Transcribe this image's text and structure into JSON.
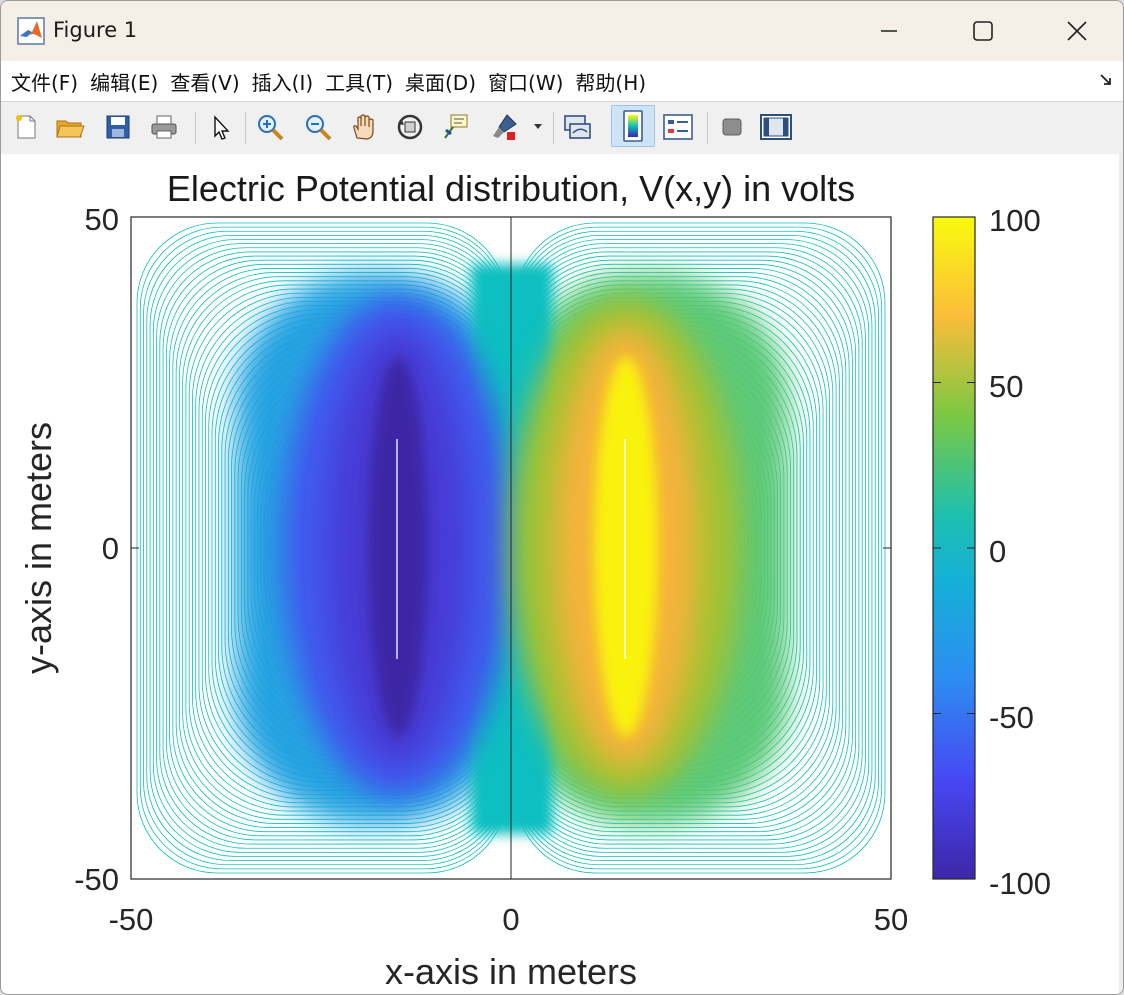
{
  "window": {
    "title": "Figure 1"
  },
  "menu": [
    {
      "label": "文件(F)"
    },
    {
      "label": "编辑(E)"
    },
    {
      "label": "查看(V)"
    },
    {
      "label": "插入(I)"
    },
    {
      "label": "工具(T)"
    },
    {
      "label": "桌面(D)"
    },
    {
      "label": "窗口(W)"
    },
    {
      "label": "帮助(H)"
    }
  ],
  "toolbar": {
    "tools": [
      "new-figure-icon",
      "open-file-icon",
      "save-icon",
      "print-icon",
      "pointer-icon",
      "zoom-in-icon",
      "zoom-out-icon",
      "pan-hand-icon",
      "rotate-3d-icon",
      "data-cursor-icon",
      "brush-icon",
      "dropdown-arrow-icon",
      "link-plot-icon",
      "colorbar-icon",
      "legend-icon",
      "hide-plot-tools-icon",
      "show-plot-tools-icon"
    ],
    "active": "colorbar-icon"
  },
  "chart_data": {
    "type": "heatmap",
    "title": "Electric Potential distribution, V(x,y) in volts",
    "xlabel": "x-axis in meters",
    "ylabel": "y-axis in meters",
    "xlim": [
      -50,
      50
    ],
    "ylim": [
      -50,
      50
    ],
    "x_ticks": [
      "-50",
      "0",
      "50"
    ],
    "y_ticks": [
      "-50",
      "0",
      "50"
    ],
    "colorbar": {
      "lim": [
        -100,
        100
      ],
      "ticks": [
        "-100",
        "-50",
        "0",
        "50",
        "100"
      ],
      "colormap": "parula"
    },
    "sources": [
      {
        "name": "negative plate",
        "x": -15,
        "y_range": [
          -25,
          25
        ],
        "potential": -100
      },
      {
        "name": "positive plate",
        "x": 15,
        "y_range": [
          -25,
          25
        ],
        "potential": 100
      }
    ],
    "boundary_potential": 0,
    "colors": {
      "min": "#3e26a8",
      "zero": "#10bfbc",
      "max": "#f9fb0e"
    }
  }
}
